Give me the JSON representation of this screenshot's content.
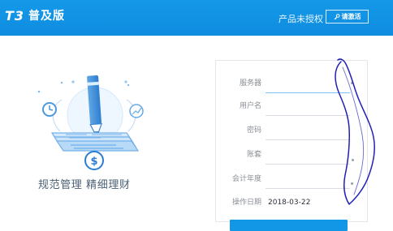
{
  "header": {
    "logo_prefix": "T3",
    "product_name": "普及版",
    "license_status": "产品未授权",
    "activate_label": "请激活"
  },
  "branding": {
    "slogan": "规范管理  精细理财"
  },
  "login_form": {
    "fields": [
      {
        "label": "服务器",
        "value": ""
      },
      {
        "label": "用户名",
        "value": ""
      },
      {
        "label": "密码",
        "value": ""
      },
      {
        "label": "账套",
        "value": ""
      },
      {
        "label": "会计年度",
        "value": ""
      },
      {
        "label": "操作日期",
        "value": "2018-03-22"
      }
    ]
  },
  "colors": {
    "header": "#1598e8",
    "accent": "#0f8de0",
    "scribble": "#1b1bb4"
  },
  "icons": {
    "key": "key-icon",
    "illustration": "finance-management-illustration"
  }
}
